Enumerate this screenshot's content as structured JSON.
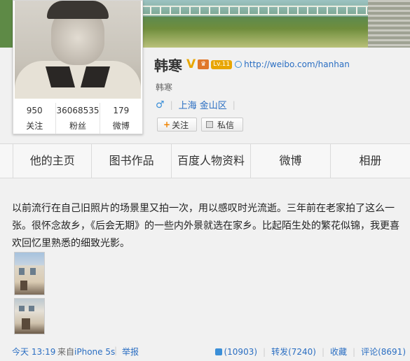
{
  "profile": {
    "name": "韩寒",
    "verified_badge": "V",
    "level": "Lv.11",
    "website": "http://weibo.com/hanhan",
    "nickname": "韩寒",
    "gender_symbol": "♂",
    "location": "上海 金山区",
    "stats": [
      {
        "value": "950",
        "label": "关注"
      },
      {
        "value": "36068535",
        "label": "粉丝"
      },
      {
        "value": "179",
        "label": "微博"
      }
    ],
    "follow_button": "关注",
    "follow_plus": "+",
    "message_button": "私信"
  },
  "tabs": [
    "他的主页",
    "图书作品",
    "百度人物资料",
    "微博",
    "相册"
  ],
  "post": {
    "text": "以前流行在自己旧照片的场景里又拍一次，用以感叹时光流逝。三年前在老家拍了这么一张。很怀念故乡，《后会无期》的一些内外景就选在家乡。比起陌生处的繁花似锦，我更喜欢回忆里熟悉的细致光影。",
    "time": "今天 13:19",
    "from_prefix": "来自",
    "device": "iPhone 5s",
    "separator": "|",
    "report": "举报",
    "likes": "(10903)",
    "repost": "转发(7240)",
    "favorite": "收藏",
    "comment": "评论(8691)"
  },
  "colors": {
    "link": "#2a6ec2",
    "verified": "#e8a600",
    "follow_plus": "#f08300"
  }
}
